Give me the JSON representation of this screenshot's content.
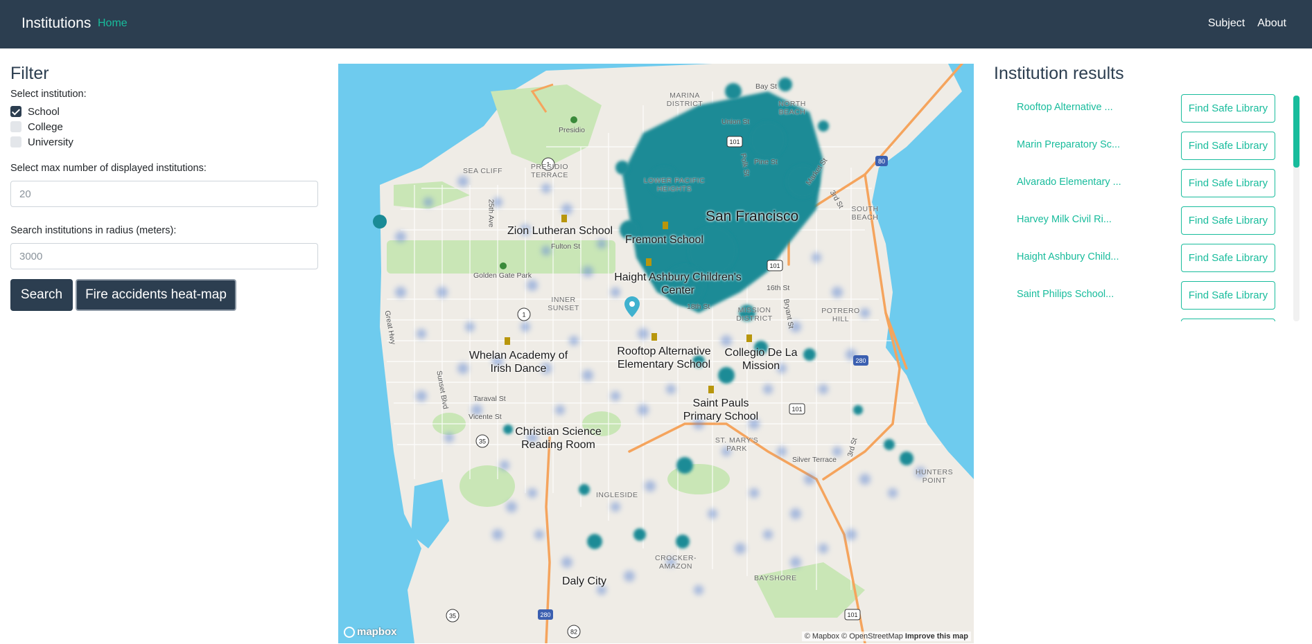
{
  "navbar": {
    "brand": "Institutions",
    "home": "Home",
    "subject": "Subject",
    "about": "About"
  },
  "filter": {
    "title": "Filter",
    "select_institution_label": "Select institution:",
    "options": [
      {
        "label": "School",
        "checked": true
      },
      {
        "label": "College",
        "checked": false
      },
      {
        "label": "University",
        "checked": false
      }
    ],
    "max_label": "Select max number of displayed institutions:",
    "max_placeholder": "20",
    "radius_label": "Search institutions in radius (meters):",
    "radius_placeholder": "3000",
    "search_button": "Search",
    "heatmap_button": "Fire accidents heat-map"
  },
  "map": {
    "city": "San Francisco",
    "institutions": [
      "Zion Lutheran School",
      "Fremont School",
      "Haight Ashbury Children's Center",
      "Whelan Academy of Irish Dance",
      "Rooftop Alternative Elementary School",
      "Collegio De La Mission",
      "Saint Pauls Primary School",
      "Christian Science Reading Room",
      "Daly City"
    ],
    "districts": [
      "MARINA DISTRICT",
      "NORTH BEACH",
      "SEA CLIFF",
      "PRESIDIO TERRACE",
      "LOWER PACIFIC HEIGHTS",
      "SOUTH BEACH",
      "INNER SUNSET",
      "MISSION DISTRICT",
      "POTRERO HILL",
      "ST. MARY'S PARK",
      "HUNTERS POINT",
      "INGLESIDE",
      "CROCKER-AMAZON",
      "BAYSHORE"
    ],
    "streets": [
      "Bay St",
      "Union St",
      "Pine St",
      "Polk St",
      "Market St",
      "3rd St",
      "Presidio",
      "Golden Gate Park",
      "Fulton St",
      "25th Ave",
      "Great Hwy",
      "Sunset Blvd",
      "Taraval St",
      "Vicente St",
      "16th St",
      "18th St",
      "Bryant St",
      "Silver Terrace"
    ],
    "route_shields": [
      "1",
      "101",
      "80",
      "280",
      "35",
      "82"
    ],
    "logo": "mapbox",
    "attribution_text": "© Mapbox © OpenStreetMap",
    "improve_link": "Improve this map",
    "heat_color": "#1a8b96"
  },
  "results": {
    "title": "Institution results",
    "button_label": "Find Safe Library",
    "items": [
      "Rooftop Alternative ...",
      "Marin Preparatory Sc...",
      "Alvarado Elementary ...",
      "Harvey Milk Civil Ri...",
      "Haight Ashbury Child...",
      "Saint Philips School..."
    ]
  }
}
